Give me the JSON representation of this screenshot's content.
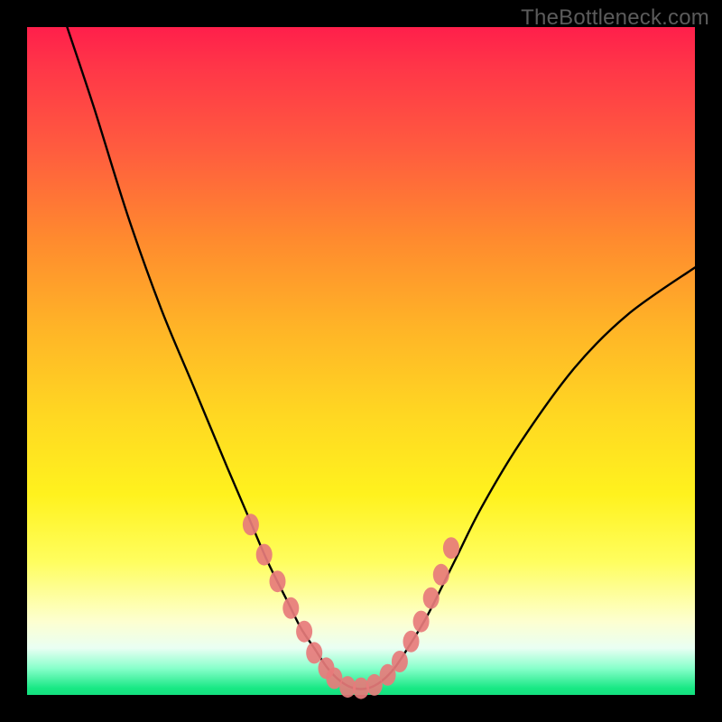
{
  "watermark": "TheBottleneck.com",
  "chart_data": {
    "type": "line",
    "title": "",
    "xlabel": "",
    "ylabel": "",
    "xlim": [
      0,
      100
    ],
    "ylim": [
      0,
      100
    ],
    "series": [
      {
        "name": "curve",
        "x": [
          6,
          10,
          15,
          20,
          25,
          30,
          33,
          36,
          39,
          41,
          43,
          45,
          47,
          49,
          51,
          53,
          55,
          57,
          60,
          64,
          68,
          74,
          82,
          90,
          100
        ],
        "y": [
          100,
          88,
          72,
          58,
          46,
          34,
          27,
          20,
          14,
          10,
          7,
          4,
          2,
          1,
          1,
          2,
          4,
          7,
          12,
          20,
          28,
          38,
          49,
          57,
          64
        ]
      }
    ],
    "markers": {
      "name": "dots",
      "color": "#e77b7b",
      "x": [
        33.5,
        35.5,
        37.5,
        39.5,
        41.5,
        43.0,
        44.8,
        46.0,
        48.0,
        50.0,
        52.0,
        54.0,
        55.8,
        57.5,
        59.0,
        60.5,
        62.0,
        63.5
      ],
      "y": [
        25.5,
        21.0,
        17.0,
        13.0,
        9.5,
        6.3,
        4.0,
        2.5,
        1.2,
        1.0,
        1.5,
        3.0,
        5.0,
        8.0,
        11.0,
        14.5,
        18.0,
        22.0
      ]
    }
  }
}
